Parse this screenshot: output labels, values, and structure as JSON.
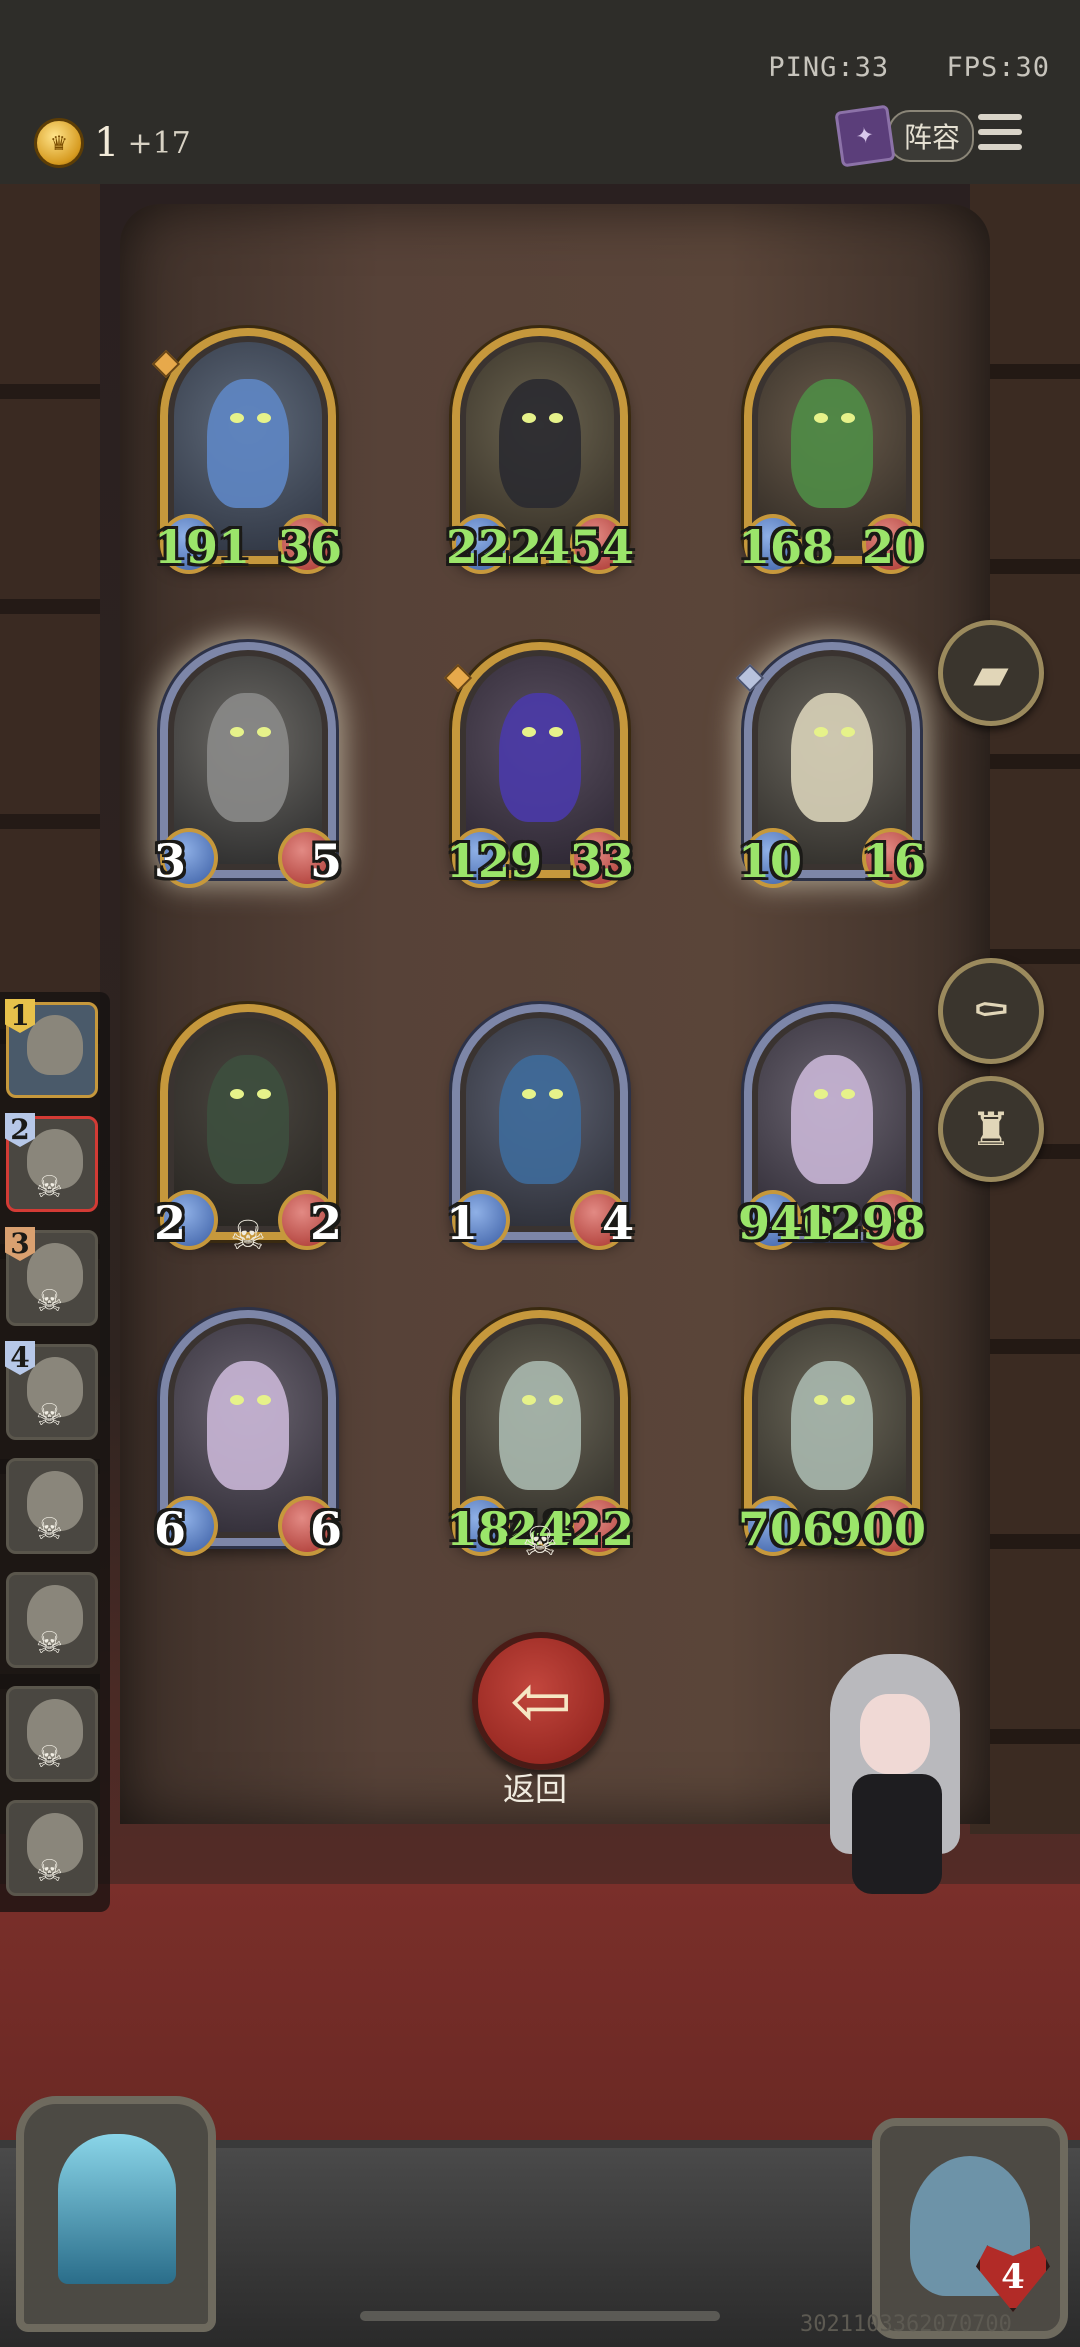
{
  "top_bar": {
    "ping": "PING:33",
    "fps": "FPS:30",
    "coins": "1",
    "coin_income": "+17",
    "lineup_label": "阵容",
    "menu_icon": "hamburger-menu-icon"
  },
  "board": {
    "cards": [
      {
        "name": "blue-dragon-card",
        "atk": "191",
        "hp": "36",
        "atk_buffed": true,
        "hp_buffed": true,
        "frame": "gold",
        "c1": "#5f6a7a",
        "c2": "#2d3340",
        "c3": "#5e86c4"
      },
      {
        "name": "black-dragon-card",
        "atk": "222",
        "hp": "454",
        "atk_buffed": true,
        "hp_buffed": true,
        "frame": "gold",
        "c1": "#6b6450",
        "c2": "#302a22",
        "c3": "#2a2a30"
      },
      {
        "name": "green-dragon-card",
        "atk": "168",
        "hp": "20",
        "atk_buffed": true,
        "hp_buffed": true,
        "frame": "gold",
        "c1": "#6a5c4c",
        "c2": "#2e2822",
        "c3": "#4f8c46"
      },
      {
        "name": "bone-dragon-card",
        "atk": "3",
        "hp": "5",
        "atk_buffed": false,
        "hp_buffed": false,
        "frame": "silver",
        "glow": true,
        "c1": "#6c6a66",
        "c2": "#2a2a2a",
        "c3": "#8a8a88"
      },
      {
        "name": "purple-dragon-card",
        "atk": "129",
        "hp": "33",
        "atk_buffed": true,
        "hp_buffed": true,
        "frame": "gold",
        "c1": "#5a5060",
        "c2": "#2a2430",
        "c3": "#4a3aa8"
      },
      {
        "name": "white-serpent-dragon-card",
        "atk": "10",
        "hp": "16",
        "atk_buffed": true,
        "hp_buffed": true,
        "frame": "silver",
        "glow": true,
        "c1": "#6a665e",
        "c2": "#2e2c28",
        "c3": "#d8d2b8"
      },
      {
        "name": "treasure-chest-mimic-card",
        "atk": "2",
        "hp": "2",
        "atk_buffed": false,
        "hp_buffed": false,
        "frame": "gold",
        "skull": true,
        "c1": "#4a4640",
        "c2": "#26231f",
        "c3": "#3d4f3e"
      },
      {
        "name": "mushroom-goblin-card",
        "atk": "1",
        "hp": "4",
        "atk_buffed": false,
        "hp_buffed": false,
        "frame": "silver",
        "c1": "#5c6070",
        "c2": "#2a2c34",
        "c3": "#3e6a9a"
      },
      {
        "name": "masked-priestess-card",
        "atk": "946",
        "hp": "1298",
        "atk_buffed": true,
        "hp_buffed": true,
        "frame": "silver",
        "c1": "#6a6470",
        "c2": "#2e2a34",
        "c3": "#c9b6d6"
      },
      {
        "name": "masked-priestess-card-2",
        "atk": "6",
        "hp": "6",
        "atk_buffed": false,
        "hp_buffed": false,
        "frame": "silver",
        "c1": "#6a6470",
        "c2": "#2e2a34",
        "c3": "#c9b6d6"
      },
      {
        "name": "hooded-nun-card",
        "atk": "1848",
        "hp": "2422",
        "atk_buffed": true,
        "hp_buffed": true,
        "frame": "gold",
        "skull": true,
        "c1": "#6a6658",
        "c2": "#2c2a24",
        "c3": "#a9b8ae"
      },
      {
        "name": "hooded-nun-card-2",
        "atk": "706",
        "hp": "900",
        "atk_buffed": true,
        "hp_buffed": true,
        "frame": "gold",
        "c1": "#6a6658",
        "c2": "#2c2a24",
        "c3": "#a9b8ae"
      }
    ]
  },
  "tiers": [
    {
      "num": "1",
      "style": "gold",
      "active": true
    },
    {
      "num": "2",
      "style": "blue",
      "current": true,
      "skull": true
    },
    {
      "num": "3",
      "style": "orange",
      "skull": true
    },
    {
      "num": "4",
      "style": "blue",
      "skull": true
    },
    {
      "num": "",
      "skull": true
    },
    {
      "num": "",
      "skull": true
    },
    {
      "num": "",
      "skull": true
    },
    {
      "num": "",
      "skull": true
    }
  ],
  "actions": {
    "return_label": "返回",
    "return_icon": "arrow-left-icon",
    "book_icon": "book-icon",
    "coffin_icon": "coffin-icon",
    "candles_icon": "candles-icon"
  },
  "hero": {
    "health": "4"
  },
  "build_id": "3021103362070700"
}
